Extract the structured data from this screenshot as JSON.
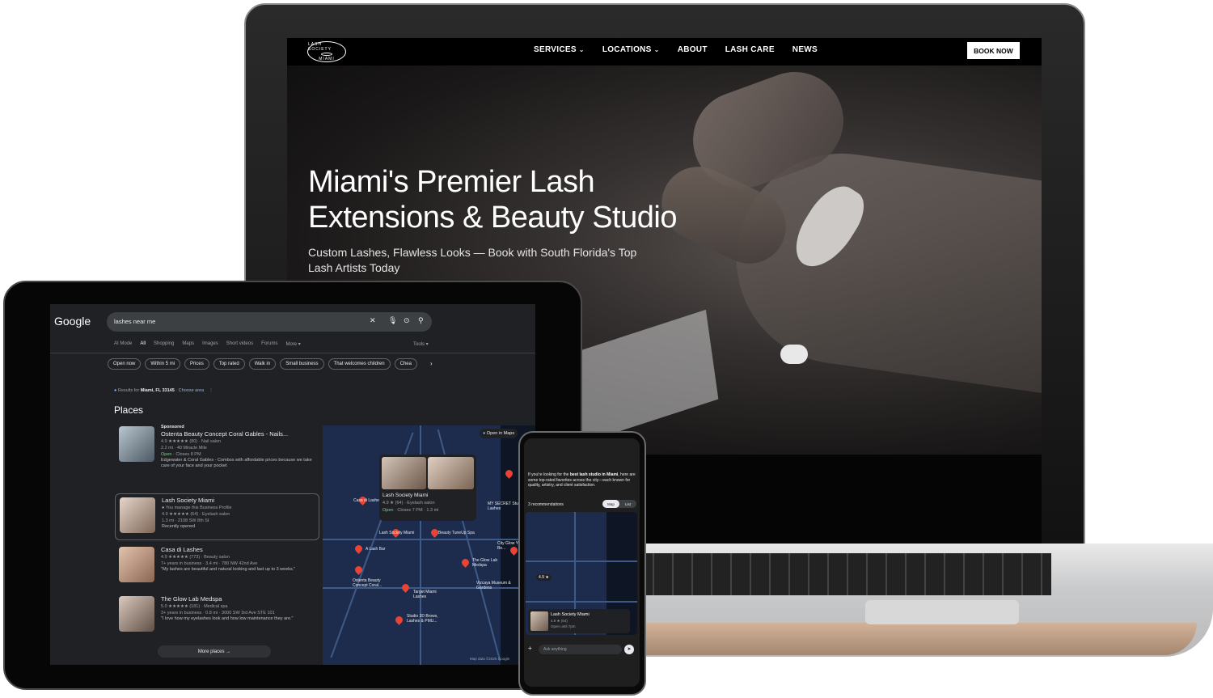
{
  "website": {
    "logo": {
      "line1": "LASH SOCIETY",
      "line2": "MIAMI"
    },
    "nav": [
      "SERVICES",
      "LOCATIONS",
      "ABOUT",
      "LASH CARE",
      "NEWS"
    ],
    "book_now": "BOOK NOW",
    "hero_title": "Miami's Premier Lash Extensions & Beauty Studio",
    "hero_subtitle": "Custom Lashes, Flawless Looks — Book with South Florida's Top Lash Artists Today"
  },
  "google": {
    "logo": "Google",
    "query": "lashes near me",
    "tabs": [
      "AI Mode",
      "All",
      "Shopping",
      "Maps",
      "Images",
      "Short videos",
      "Forums",
      "More ▾"
    ],
    "tools": "Tools ▾",
    "chips": [
      "Open now",
      "Within 5 mi",
      "Prices",
      "Top rated",
      "Walk in",
      "Small business",
      "That welcomes children",
      "Chea"
    ],
    "results_prefix": "Results for",
    "location": "Miami, FL 33145",
    "choose_area": "Choose area",
    "places_heading": "Places",
    "places": [
      {
        "sponsored": "Sponsored",
        "name": "Ostenta Beauty Concept Coral Gables - Nails...",
        "rating": "4.9 ★★★★★ (80) · Nail salon",
        "line2": "2.2 mi · 40 Miracle Mile",
        "open": "Open",
        "hours": " · Closes 8 PM",
        "review": "Edgewater & Coral Gables - Combos with affordable prices because we take care of your face and your pocket"
      },
      {
        "name": "Lash Society Miami",
        "line0": "You manage this Business Profile",
        "rating": "4.9 ★★★★★ (64) · Eyelash salon",
        "line2": "1.3 mi · 2108 SW 8th St",
        "review": "Recently opened"
      },
      {
        "name": "Casa di Lashes",
        "rating": "4.9 ★★★★★ (773) · Beauty salon",
        "line2": "7+ years in business · 3.4 mi · 780 NW 42nd Ave",
        "review": "\"My lashes are beautiful and natural looking and last up to 3 weeks.\""
      },
      {
        "name": "The Glow Lab Medspa",
        "rating": "5.0 ★★★★★ (181) · Medical spa",
        "line2": "3+ years in business · 0.8 mi · 3000 SW 3rd Ave STE 101",
        "review": "\"I love how my eyelashes look and how low maintenance they are.\""
      }
    ],
    "more_places": "More places →",
    "map": {
      "open_in_maps": "Open in Maps",
      "credit": "Map data ©2025 Google",
      "card_name": "Lash Society Miami",
      "card_rating": "4.9 ★ (64) · Eyelash salon",
      "card_open": "Open",
      "card_hours": " · Closes 7 PM · 1.3 mi",
      "labels": [
        "Casa di Lashes",
        "A Lash Bar",
        "Lash Society Miami",
        "Beauty TuneUp Spa",
        "The Glow Lab Medspa",
        "Ostenta Beauty Concept Coral...",
        "Target Miami Lashes",
        "Studio 3D Brows, Lashes & PMU...",
        "Vizcaya Museum & Gardens",
        "MY SECRET Studio - Lashes",
        "City Glow Your Be..."
      ]
    }
  },
  "phone": {
    "intro_prefix": "If you're looking for the ",
    "intro_bold": "best lash studio in Miami",
    "intro_rest": ", here are some top-rated favorites across the city—each known for quality, artistry, and client satisfaction.",
    "recs": "3 recommendations",
    "toggle": [
      "Map",
      "List"
    ],
    "rating_pin": "4.9 ★",
    "card_name": "Lash Society Miami",
    "card_rating": "4.9 ★ (64)",
    "card_open": "Open until 7pm",
    "ask": "Ask anything"
  }
}
